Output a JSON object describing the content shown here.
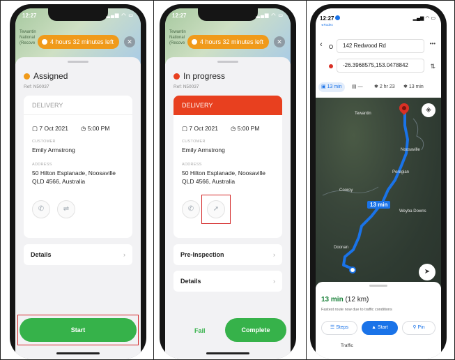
{
  "phone1": {
    "status_time": "12:27",
    "timer": "4 hours 32 minutes left",
    "map_label": [
      "Tewantin",
      "National",
      "(Recove"
    ],
    "status_title": "Assigned",
    "status_color": "#f09a1a",
    "ref": "Ref: N50037",
    "card_header": "DELIVERY",
    "date": "7 Oct 2021",
    "time": "5:00 PM",
    "customer_label": "CUSTOMER",
    "customer_name": "Emily Armstrong",
    "address_label": "ADDRESS",
    "address_line1": "50 Hilton Esplanade, Noosaville",
    "address_line2": "QLD 4566, Australia",
    "rows": [
      {
        "label": "Details"
      }
    ],
    "start_button": "Start",
    "chevron": "›"
  },
  "phone2": {
    "status_time": "12:27",
    "timer": "4 hours 32 minutes left",
    "map_label": [
      "Tewantin",
      "National",
      "(Recove"
    ],
    "status_title": "In progress",
    "status_color": "#e8401f",
    "ref": "Ref: N50037",
    "card_header": "DELIVERY",
    "date": "7 Oct 2021",
    "time": "5:00 PM",
    "customer_label": "CUSTOMER",
    "customer_name": "Emily Armstrong",
    "address_label": "ADDRESS",
    "address_line1": "50 Hilton Esplanade, Noosaville",
    "address_line2": "QLD 4566, Australia",
    "rows": [
      {
        "label": "Pre-Inspection"
      },
      {
        "label": "Details"
      }
    ],
    "fail_button": "Fail",
    "complete_button": "Complete",
    "chevron": "›"
  },
  "phone3": {
    "status_time": "12:27",
    "back_label": "◂ Rodeo",
    "origin": "142 Redwood Rd",
    "destination": "-26.3968575,153.0478842",
    "modes": [
      {
        "label": "13 min",
        "icon": "car-icon"
      },
      {
        "label": "—",
        "icon": "transit-icon"
      },
      {
        "label": "2 hr 23",
        "icon": "walk-icon"
      },
      {
        "label": "13 min",
        "icon": "rideshare-icon"
      }
    ],
    "route_badge": "13 min",
    "places": [
      "Tewantin",
      "Noosaville",
      "Cooroy",
      "Doonan",
      "Weyba Downs",
      "Peregian"
    ],
    "eta": "13 min",
    "distance": "(12 km)",
    "subtitle": "Fastest route now due to traffic conditions",
    "steps_button": "Steps",
    "start_button": "Start",
    "pin_button": "Pin",
    "traffic_label": "Traffic"
  }
}
